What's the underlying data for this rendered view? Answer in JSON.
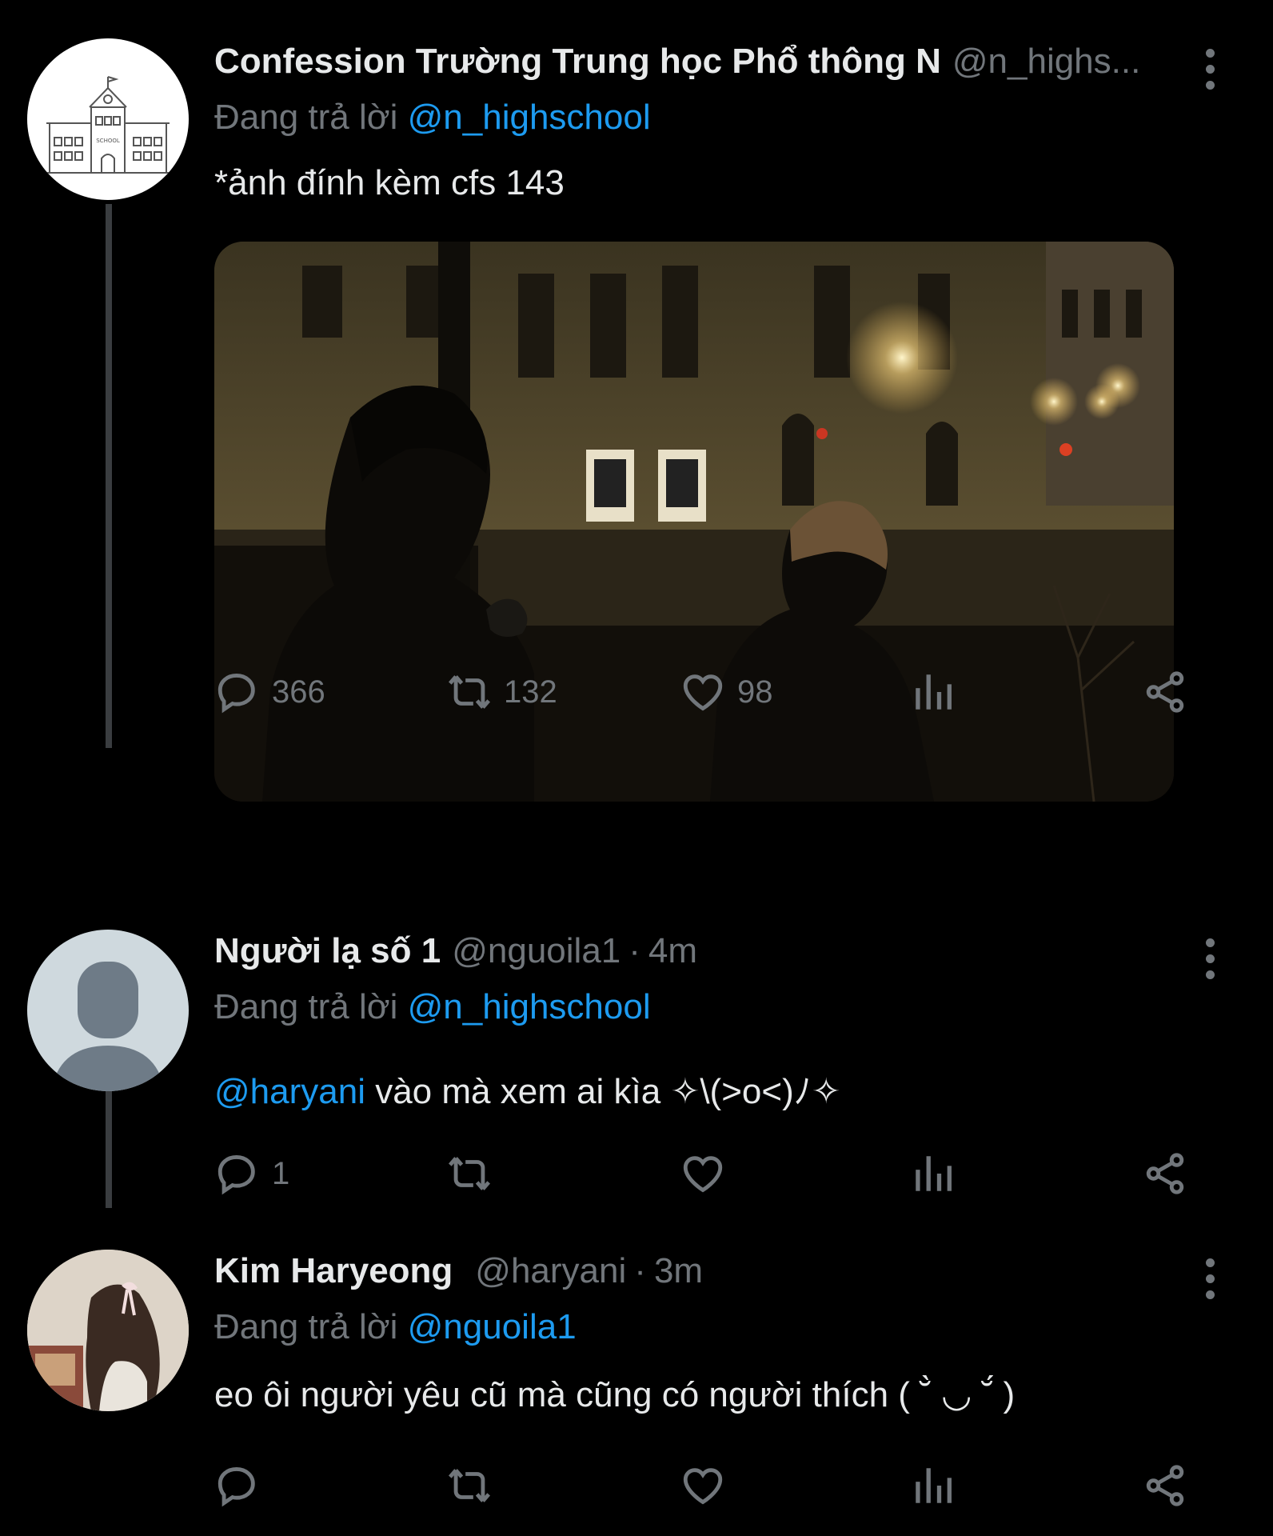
{
  "tweets": [
    {
      "name": "Confession Trường Trung học Phổ thông N",
      "handle": "@n_highs...",
      "time": "",
      "reply_prefix": "Đang trả lời ",
      "reply_to": "@n_highschool",
      "text": "*ảnh đính kèm cfs 143",
      "avatar": "school-building-logo",
      "avatar_text": "SCHOOL",
      "has_media": true,
      "stats": {
        "replies": "366",
        "retweets": "132",
        "likes": "98"
      }
    },
    {
      "name": "Người lạ số 1",
      "handle": "@nguoila1",
      "separator": "·",
      "time": "4m",
      "reply_prefix": "Đang trả lời ",
      "reply_to": "@n_highschool",
      "mention": "@haryani",
      "text": " vào mà xem ai kìa ✧\\(>o<)ﾉ✧",
      "avatar": "default-user-avatar",
      "stats": {
        "replies": "1",
        "retweets": "",
        "likes": ""
      }
    },
    {
      "name": "Kim Haryeong",
      "handle": "@haryani",
      "separator": "·",
      "time": "3m",
      "reply_prefix": "Đang trả lời ",
      "reply_to": "@nguoila1",
      "text": "eo ôi người yêu cũ mà cũng có người thích ( ˘̀ ◡ ˘́ )",
      "avatar": "profile-photo",
      "stats": {
        "replies": "",
        "retweets": "",
        "likes": ""
      }
    }
  ],
  "icons": [
    "reply-icon",
    "retweet-icon",
    "like-icon",
    "analytics-icon",
    "share-icon",
    "more-icon"
  ],
  "colors": {
    "background": "#000000",
    "text": "#e7e9ea",
    "secondary": "#71767b",
    "link": "#1d9bf0"
  }
}
